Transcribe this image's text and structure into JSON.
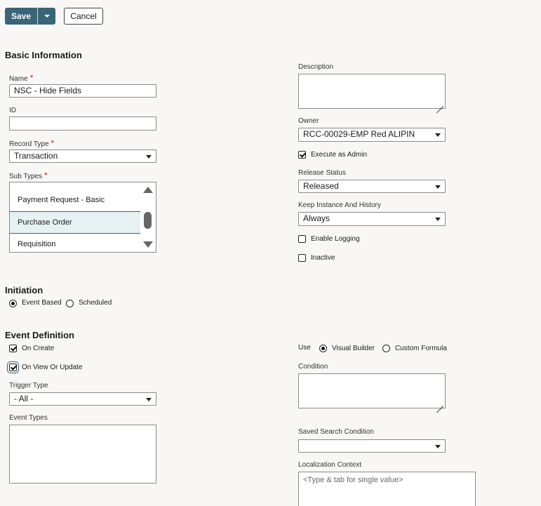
{
  "toolbar": {
    "save_label": "Save",
    "cancel_label": "Cancel"
  },
  "basic": {
    "title": "Basic Information",
    "name_label": "Name",
    "name_value": "NSC - Hide Fields",
    "id_label": "ID",
    "id_value": "",
    "record_type_label": "Record Type",
    "record_type_value": "Transaction",
    "sub_types_label": "Sub Types",
    "sub_types": [
      "Payment Request - Basic",
      "Purchase Order",
      "Requisition"
    ],
    "required_mark": "*",
    "description_label": "Description",
    "owner_label": "Owner",
    "owner_value": "RCC-00029-EMP Red  ALIPIN",
    "execute_admin_label": "Execute as Admin",
    "release_status_label": "Release Status",
    "release_status_value": "Released",
    "keep_label": "Keep Instance And History",
    "keep_value": "Always",
    "logging_label": "Enable Logging",
    "inactive_label": "Inactive"
  },
  "initiation": {
    "title": "Initiation",
    "event_based_label": "Event Based",
    "scheduled_label": "Scheduled"
  },
  "event": {
    "title": "Event Definition",
    "on_create_label": "On Create",
    "on_view_label": "On View Or Update",
    "trigger_label": "Trigger Type",
    "trigger_value": "- All -",
    "event_types_label": "Event Types",
    "use_label": "Use",
    "visual_builder_label": "Visual Builder",
    "custom_formula_label": "Custom Formula",
    "condition_label": "Condition",
    "saved_search_label": "Saved Search Condition",
    "saved_search_value": "",
    "localization_label": "Localization Context",
    "localization_placeholder": "<Type & tab for single value>"
  }
}
